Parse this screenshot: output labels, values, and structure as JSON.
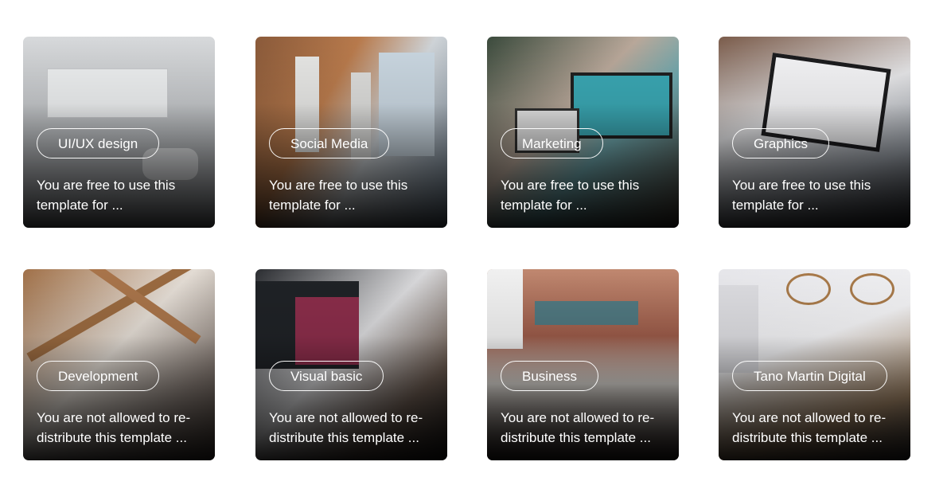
{
  "cards": [
    {
      "tag": "UI/UX design",
      "description": "You are free to use this template for ..."
    },
    {
      "tag": "Social Media",
      "description": "You are free to use this template for ..."
    },
    {
      "tag": "Marketing",
      "description": "You are free to use this template for ..."
    },
    {
      "tag": "Graphics",
      "description": "You are free to use this template for ..."
    },
    {
      "tag": "Development",
      "description": "You are not allowed to re-distribute this template ..."
    },
    {
      "tag": "Visual basic",
      "description": "You are not allowed to re-distribute this template ..."
    },
    {
      "tag": "Business",
      "description": "You are not allowed to re-distribute this template ..."
    },
    {
      "tag": "Tano Martin Digital",
      "description": "You are not allowed to re-distribute this template ..."
    }
  ]
}
